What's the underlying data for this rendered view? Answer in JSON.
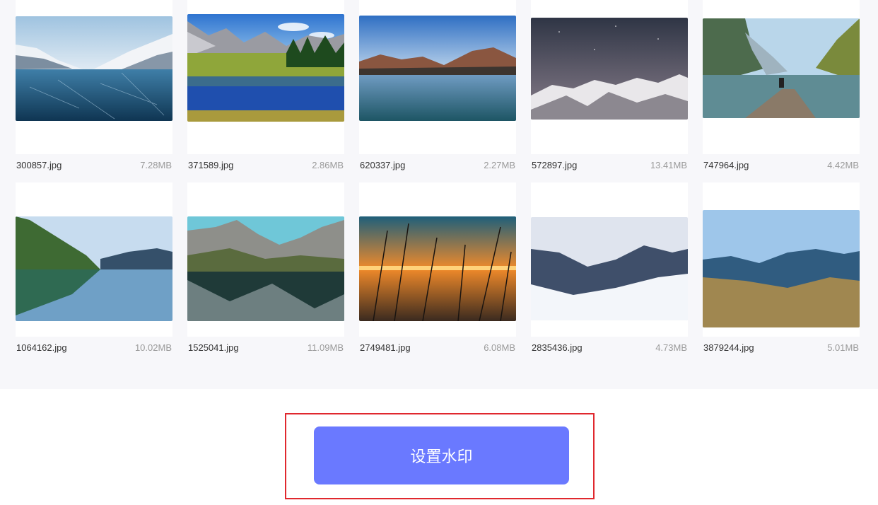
{
  "accent_color": "#6a79ff",
  "highlight_color": "#e0282e",
  "images": [
    {
      "name": "300857.jpg",
      "size": "7.28MB",
      "scene": "frozen-lake-snowy-mountains"
    },
    {
      "name": "371589.jpg",
      "size": "2.86MB",
      "scene": "alpine-lake-green-meadow"
    },
    {
      "name": "620337.jpg",
      "size": "2.27MB",
      "scene": "mountain-lake-blue-sky"
    },
    {
      "name": "572897.jpg",
      "size": "13.41MB",
      "scene": "snowy-peaks-night-sky"
    },
    {
      "name": "747964.jpg",
      "size": "4.42MB",
      "scene": "lake-pier-person-mountains"
    },
    {
      "name": "1064162.jpg",
      "size": "10.02MB",
      "scene": "forest-lake-reflection"
    },
    {
      "name": "1525041.jpg",
      "size": "11.09MB",
      "scene": "rocky-mountain-lake-reflection"
    },
    {
      "name": "2749481.jpg",
      "size": "6.08MB",
      "scene": "sunset-reeds-lake"
    },
    {
      "name": "2835436.jpg",
      "size": "4.73MB",
      "scene": "snowy-mountain-ridge"
    },
    {
      "name": "3879244.jpg",
      "size": "5.01MB",
      "scene": "hills-valley-panorama"
    }
  ],
  "action": {
    "set_watermark_label": "设置水印"
  }
}
